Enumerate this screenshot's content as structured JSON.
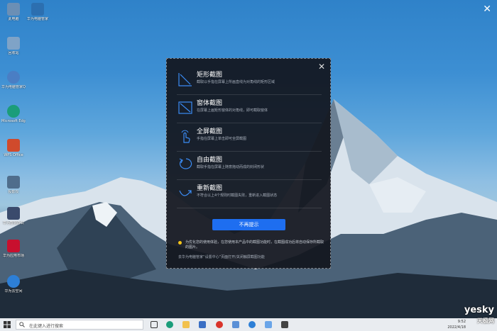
{
  "desktop": {
    "icons": [
      {
        "label": "此电脑",
        "color": "#6b8fb5"
      },
      {
        "label": "华为电脑管家",
        "color": "#2c6fb0"
      },
      {
        "label": "回收站",
        "color": "#7fa3c7"
      },
      {
        "label": "华为电脑管家QQ",
        "color": "#4a7ec4"
      },
      {
        "label": "Microsoft Edge",
        "color": "#1b9d7a"
      },
      {
        "label": "WPS Office",
        "color": "#d04a2c"
      },
      {
        "label": "投影仪",
        "color": "#4f6d8c"
      },
      {
        "label": "华为智慧办公",
        "color": "#3a4a6c"
      },
      {
        "label": "华为应用市场",
        "color": "#c8102e"
      },
      {
        "label": "华为云空间",
        "color": "#2d7fd6"
      }
    ]
  },
  "dialog": {
    "options": [
      {
        "title": "矩形截图",
        "desc": "截取以手指在屏幕上所画直线为对角线的矩形区域"
      },
      {
        "title": "窗体截图",
        "desc": "在屏幕上画矩形窗体的对角线，即可截取窗体"
      },
      {
        "title": "全屏截图",
        "desc": "手指在屏幕上单击即可全屏截图"
      },
      {
        "title": "自由截图",
        "desc": "截取手指在屏幕上随意拖动而成的封闭形状"
      },
      {
        "title": "重新截图",
        "desc": "不符合以上4个规则时截图失败，重新进入截图状态"
      }
    ],
    "button_label": "不再提示",
    "notice": "为优化您的使用体验，在您使用本产品中的截图功能时，在截图成功后将自动保存所截取的图片。",
    "footer": "去华为电脑管家“设置中心”页面打开/关闭触屏截图功能"
  },
  "taskbar": {
    "search_placeholder": "在此键入进行搜索",
    "clock_time": "9:52",
    "clock_date": "2022/4/18"
  },
  "watermark": {
    "line1": "yesky",
    "line2": "天极网"
  }
}
